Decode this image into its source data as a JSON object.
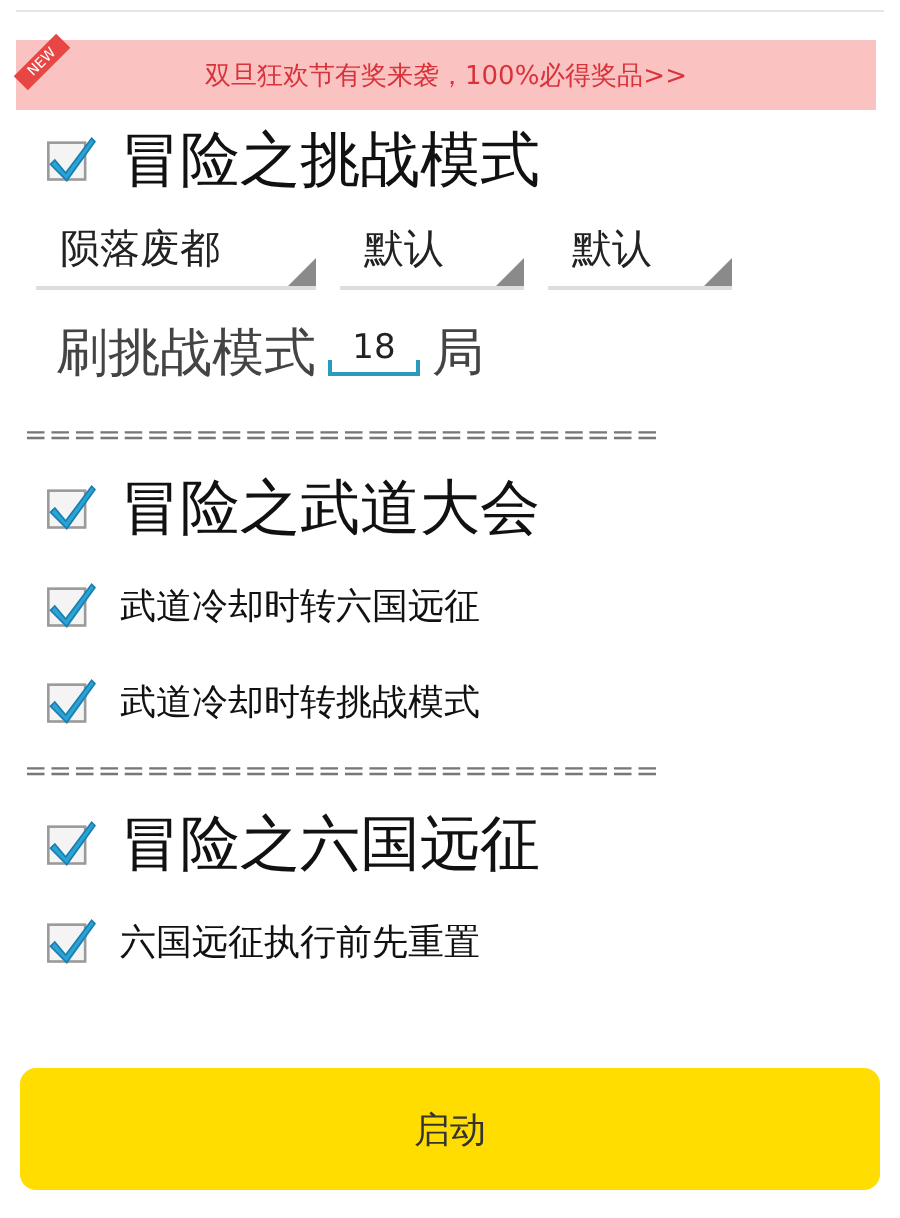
{
  "banner": {
    "badge": "NEW",
    "text": "双旦狂欢节有奖来袭，100%必得奖品>>"
  },
  "blocks": [
    {
      "kind": "header",
      "label": "冒险之挑战模式",
      "checked": true
    },
    {
      "kind": "dropdowns",
      "values": [
        "陨落废都",
        "默认",
        "默认"
      ]
    },
    {
      "kind": "count",
      "before": "刷挑战模式",
      "value": "18",
      "after": "局"
    },
    {
      "kind": "separator",
      "text": "=========================="
    },
    {
      "kind": "header",
      "label": "冒险之武道大会",
      "checked": true
    },
    {
      "kind": "checkbox",
      "label": "武道冷却时转六国远征",
      "checked": true
    },
    {
      "kind": "checkbox",
      "label": "武道冷却时转挑战模式",
      "checked": true
    },
    {
      "kind": "separator",
      "text": "=========================="
    },
    {
      "kind": "header",
      "label": "冒险之六国远征",
      "checked": true
    },
    {
      "kind": "checkbox",
      "label": "六国远征执行前先重置",
      "checked": true
    }
  ],
  "start_button": "启动"
}
